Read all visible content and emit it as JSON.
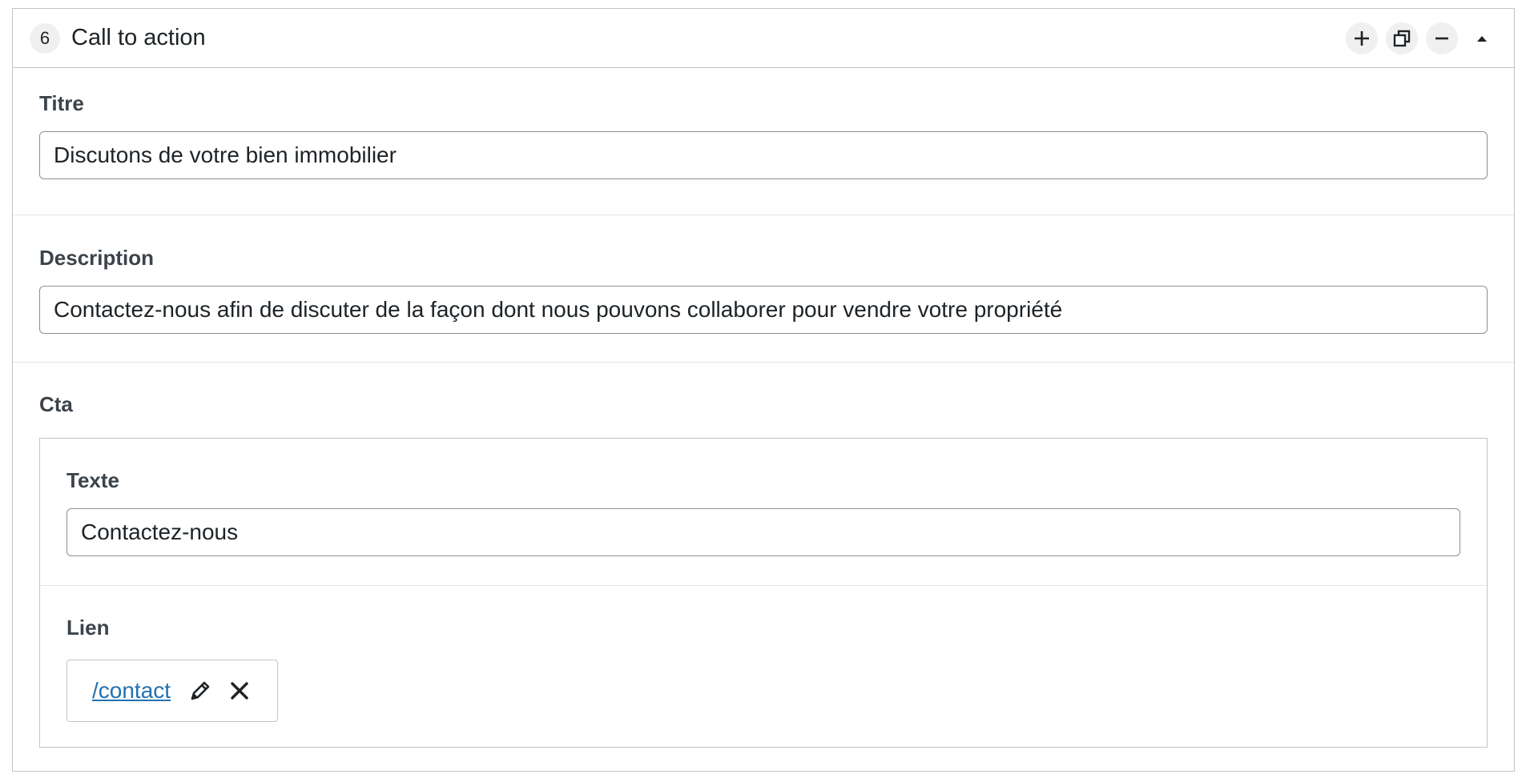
{
  "block": {
    "order": "6",
    "title": "Call to action",
    "actions": {
      "add_icon": "plus-icon",
      "duplicate_icon": "duplicate-icon",
      "remove_icon": "minus-icon",
      "collapse_icon": "triangle-up-icon"
    }
  },
  "fields": {
    "titre": {
      "label": "Titre",
      "value": "Discutons de votre bien immobilier"
    },
    "description": {
      "label": "Description",
      "value": "Contactez-nous afin de discuter de la façon dont nous pouvons collaborer pour vendre votre propriété"
    },
    "cta": {
      "label": "Cta",
      "texte": {
        "label": "Texte",
        "value": "Contactez-nous"
      },
      "lien": {
        "label": "Lien",
        "url": "/contact",
        "edit_icon": "pencil-icon",
        "remove_icon": "close-icon"
      }
    }
  },
  "colors": {
    "link": "#2271b1",
    "border": "#c3c4c7",
    "badge_bg": "#f0f0f1",
    "text": "#1d2327"
  }
}
